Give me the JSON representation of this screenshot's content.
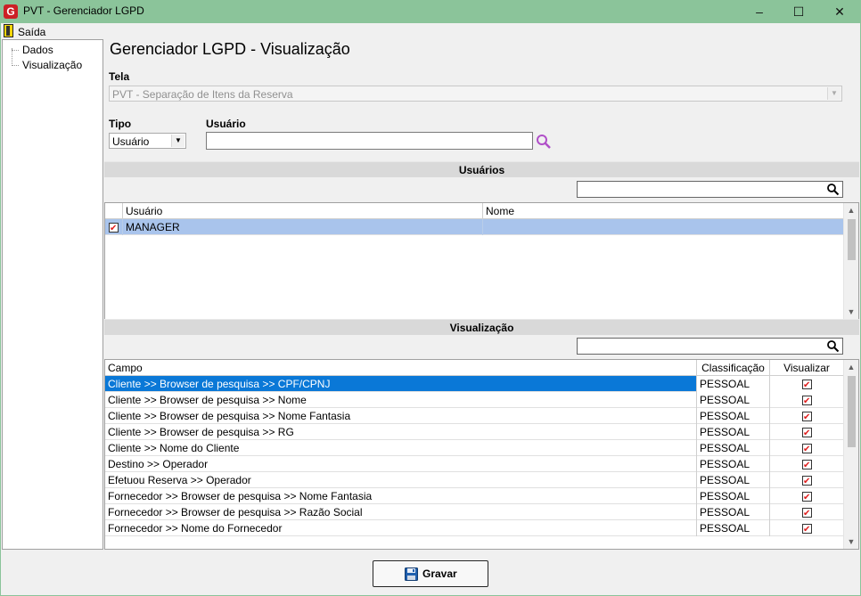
{
  "window": {
    "title": "PVT - Gerenciador LGPD",
    "app_icon_letter": "G",
    "minimize": "–",
    "maximize": "☐",
    "close": "✕"
  },
  "menu": {
    "exit_label": "Saída"
  },
  "tree": {
    "items": [
      {
        "label": "Dados"
      },
      {
        "label": "Visualização"
      }
    ]
  },
  "page": {
    "title": "Gerenciador LGPD - Visualização"
  },
  "tela": {
    "label": "Tela",
    "value": "PVT - Separação de Itens da Reserva"
  },
  "tipo": {
    "label": "Tipo",
    "value": "Usuário"
  },
  "usuario": {
    "label": "Usuário",
    "value": ""
  },
  "users_section": {
    "title": "Usuários",
    "filter_value": "",
    "columns": [
      "Usuário",
      "Nome"
    ],
    "rows": [
      {
        "usuario": "MANAGER",
        "nome": "",
        "checked": true
      }
    ]
  },
  "view_section": {
    "title": "Visualização",
    "filter_value": "",
    "columns": [
      "Campo",
      "Classificação",
      "Visualizar"
    ],
    "rows": [
      {
        "campo": "Cliente >> Browser de pesquisa >> CPF/CPNJ",
        "classificacao": "PESSOAL",
        "visualizar": true
      },
      {
        "campo": "Cliente >> Browser de pesquisa >> Nome",
        "classificacao": "PESSOAL",
        "visualizar": true
      },
      {
        "campo": "Cliente >> Browser de pesquisa >> Nome Fantasia",
        "classificacao": "PESSOAL",
        "visualizar": true
      },
      {
        "campo": "Cliente >> Browser de pesquisa >> RG",
        "classificacao": "PESSOAL",
        "visualizar": true
      },
      {
        "campo": "Cliente >> Nome do Cliente",
        "classificacao": "PESSOAL",
        "visualizar": true
      },
      {
        "campo": "Destino >> Operador",
        "classificacao": "PESSOAL",
        "visualizar": true
      },
      {
        "campo": "Efetuou Reserva >> Operador",
        "classificacao": "PESSOAL",
        "visualizar": true
      },
      {
        "campo": "Fornecedor >> Browser de pesquisa >> Nome Fantasia",
        "classificacao": "PESSOAL",
        "visualizar": true
      },
      {
        "campo": "Fornecedor >> Browser de pesquisa >> Razão Social",
        "classificacao": "PESSOAL",
        "visualizar": true
      },
      {
        "campo": "Fornecedor >> Nome do Fornecedor",
        "classificacao": "PESSOAL",
        "visualizar": true
      }
    ]
  },
  "save_button": {
    "label": "Gravar"
  },
  "colors": {
    "titlebar": "#8bc49a",
    "selection": "#0a78d7",
    "selection_pale": "#a9c4ec",
    "check": "#e01e1e",
    "search_magnifier": "#b04fc8"
  }
}
